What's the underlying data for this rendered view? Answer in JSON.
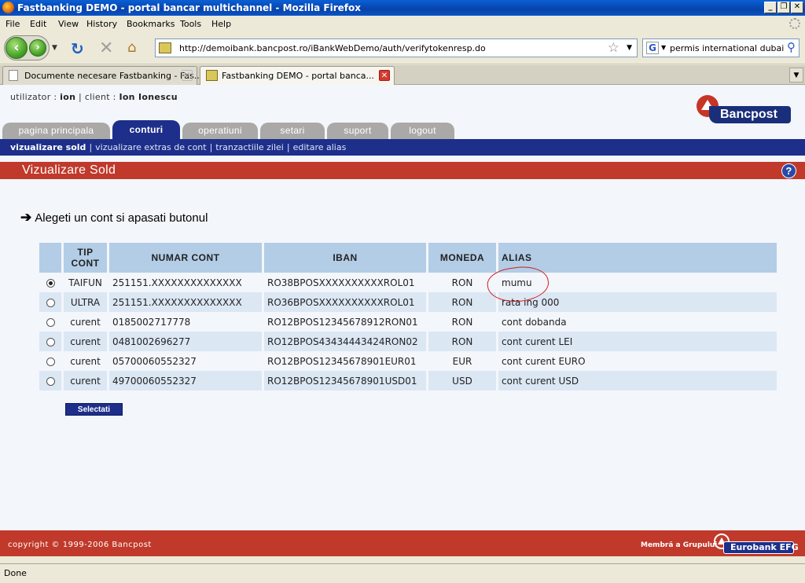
{
  "window": {
    "title": "Fastbanking DEMO - portal bancar multichannel - Mozilla Firefox"
  },
  "menu": [
    "File",
    "Edit",
    "View",
    "History",
    "Bookmarks",
    "Tools",
    "Help"
  ],
  "navbar": {
    "url": "http://demoibank.bancpost.ro/iBankWebDemo/auth/verifytokenresp.do",
    "search_value": "permis international dubai"
  },
  "tabs": [
    {
      "label": "Documente necesare Fastbanking - Fas..."
    },
    {
      "label": "Fastbanking DEMO - portal banca..."
    }
  ],
  "user": {
    "user_label": "utilizator :",
    "user_value": "ion",
    "sep": "|",
    "client_label": "client :",
    "client_value": "Ion Ionescu"
  },
  "logo": {
    "text": "Bancpost"
  },
  "main_nav": [
    "pagina principala",
    "conturi",
    "operatiuni",
    "setari",
    "suport",
    "logout"
  ],
  "sub_nav": [
    "vizualizare sold",
    "vizualizare extras de cont",
    "tranzactiile zilei",
    "editare alias"
  ],
  "sub_nav_sep": "|",
  "page_title": "Vizualizare Sold",
  "help": "?",
  "instruction": "Alegeti un cont si apasati butonul",
  "table": {
    "headers": {
      "tip_line1": "TIP",
      "tip_line2": "CONT",
      "numar": "NUMAR CONT",
      "iban": "IBAN",
      "moneda": "MONEDA",
      "alias": "ALIAS"
    },
    "rows": [
      {
        "selected": true,
        "tip": "TAIFUN",
        "numar": "251151.XXXXXXXXXXXXXX",
        "iban": "RO38BPOSXXXXXXXXXXROL01",
        "moneda": "RON",
        "alias": "mumu"
      },
      {
        "selected": false,
        "tip": "ULTRA",
        "numar": "251151.XXXXXXXXXXXXXX",
        "iban": "RO36BPOSXXXXXXXXXXROL01",
        "moneda": "RON",
        "alias": "rata ing 000"
      },
      {
        "selected": false,
        "tip": "curent",
        "numar": "0185002717778",
        "iban": "RO12BPOS12345678912RON01",
        "moneda": "RON",
        "alias": "cont dobanda"
      },
      {
        "selected": false,
        "tip": "curent",
        "numar": "0481002696277",
        "iban": "RO12BPOS43434443424RON02",
        "moneda": "RON",
        "alias": "cont curent LEI"
      },
      {
        "selected": false,
        "tip": "curent",
        "numar": "05700060552327",
        "iban": "RO12BPOS12345678901EUR01",
        "moneda": "EUR",
        "alias": "cont curent EURO"
      },
      {
        "selected": false,
        "tip": "curent",
        "numar": "49700060552327",
        "iban": "RO12BPOS12345678901USD01",
        "moneda": "USD",
        "alias": "cont curent USD"
      }
    ]
  },
  "select_button": "Selectati",
  "footer": {
    "copyright": "copyright © 1999-2006 Bancpost",
    "group_text": "Membră a Grupului",
    "group_logo": "Eurobank EFG"
  },
  "status": "Done",
  "colors": {
    "brand_blue": "#1d2f8a",
    "brand_red": "#c0392b",
    "header_blue": "#b3cde6",
    "row_alt": "#dce7f4"
  }
}
